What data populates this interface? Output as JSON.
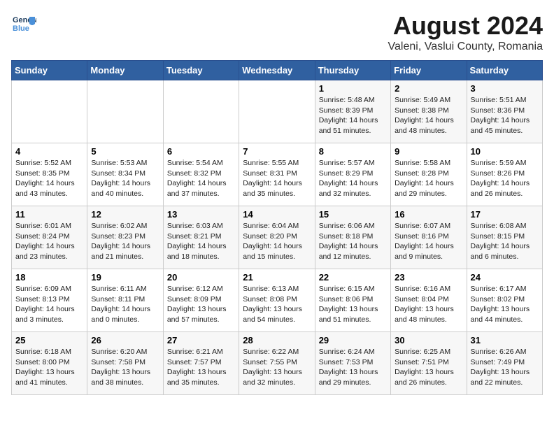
{
  "logo": {
    "line1": "General",
    "line2": "Blue"
  },
  "title": "August 2024",
  "subtitle": "Valeni, Vaslui County, Romania",
  "days_header": [
    "Sunday",
    "Monday",
    "Tuesday",
    "Wednesday",
    "Thursday",
    "Friday",
    "Saturday"
  ],
  "weeks": [
    [
      {
        "day": "",
        "info": ""
      },
      {
        "day": "",
        "info": ""
      },
      {
        "day": "",
        "info": ""
      },
      {
        "day": "",
        "info": ""
      },
      {
        "day": "1",
        "info": "Sunrise: 5:48 AM\nSunset: 8:39 PM\nDaylight: 14 hours\nand 51 minutes."
      },
      {
        "day": "2",
        "info": "Sunrise: 5:49 AM\nSunset: 8:38 PM\nDaylight: 14 hours\nand 48 minutes."
      },
      {
        "day": "3",
        "info": "Sunrise: 5:51 AM\nSunset: 8:36 PM\nDaylight: 14 hours\nand 45 minutes."
      }
    ],
    [
      {
        "day": "4",
        "info": "Sunrise: 5:52 AM\nSunset: 8:35 PM\nDaylight: 14 hours\nand 43 minutes."
      },
      {
        "day": "5",
        "info": "Sunrise: 5:53 AM\nSunset: 8:34 PM\nDaylight: 14 hours\nand 40 minutes."
      },
      {
        "day": "6",
        "info": "Sunrise: 5:54 AM\nSunset: 8:32 PM\nDaylight: 14 hours\nand 37 minutes."
      },
      {
        "day": "7",
        "info": "Sunrise: 5:55 AM\nSunset: 8:31 PM\nDaylight: 14 hours\nand 35 minutes."
      },
      {
        "day": "8",
        "info": "Sunrise: 5:57 AM\nSunset: 8:29 PM\nDaylight: 14 hours\nand 32 minutes."
      },
      {
        "day": "9",
        "info": "Sunrise: 5:58 AM\nSunset: 8:28 PM\nDaylight: 14 hours\nand 29 minutes."
      },
      {
        "day": "10",
        "info": "Sunrise: 5:59 AM\nSunset: 8:26 PM\nDaylight: 14 hours\nand 26 minutes."
      }
    ],
    [
      {
        "day": "11",
        "info": "Sunrise: 6:01 AM\nSunset: 8:24 PM\nDaylight: 14 hours\nand 23 minutes."
      },
      {
        "day": "12",
        "info": "Sunrise: 6:02 AM\nSunset: 8:23 PM\nDaylight: 14 hours\nand 21 minutes."
      },
      {
        "day": "13",
        "info": "Sunrise: 6:03 AM\nSunset: 8:21 PM\nDaylight: 14 hours\nand 18 minutes."
      },
      {
        "day": "14",
        "info": "Sunrise: 6:04 AM\nSunset: 8:20 PM\nDaylight: 14 hours\nand 15 minutes."
      },
      {
        "day": "15",
        "info": "Sunrise: 6:06 AM\nSunset: 8:18 PM\nDaylight: 14 hours\nand 12 minutes."
      },
      {
        "day": "16",
        "info": "Sunrise: 6:07 AM\nSunset: 8:16 PM\nDaylight: 14 hours\nand 9 minutes."
      },
      {
        "day": "17",
        "info": "Sunrise: 6:08 AM\nSunset: 8:15 PM\nDaylight: 14 hours\nand 6 minutes."
      }
    ],
    [
      {
        "day": "18",
        "info": "Sunrise: 6:09 AM\nSunset: 8:13 PM\nDaylight: 14 hours\nand 3 minutes."
      },
      {
        "day": "19",
        "info": "Sunrise: 6:11 AM\nSunset: 8:11 PM\nDaylight: 14 hours\nand 0 minutes."
      },
      {
        "day": "20",
        "info": "Sunrise: 6:12 AM\nSunset: 8:09 PM\nDaylight: 13 hours\nand 57 minutes."
      },
      {
        "day": "21",
        "info": "Sunrise: 6:13 AM\nSunset: 8:08 PM\nDaylight: 13 hours\nand 54 minutes."
      },
      {
        "day": "22",
        "info": "Sunrise: 6:15 AM\nSunset: 8:06 PM\nDaylight: 13 hours\nand 51 minutes."
      },
      {
        "day": "23",
        "info": "Sunrise: 6:16 AM\nSunset: 8:04 PM\nDaylight: 13 hours\nand 48 minutes."
      },
      {
        "day": "24",
        "info": "Sunrise: 6:17 AM\nSunset: 8:02 PM\nDaylight: 13 hours\nand 44 minutes."
      }
    ],
    [
      {
        "day": "25",
        "info": "Sunrise: 6:18 AM\nSunset: 8:00 PM\nDaylight: 13 hours\nand 41 minutes."
      },
      {
        "day": "26",
        "info": "Sunrise: 6:20 AM\nSunset: 7:58 PM\nDaylight: 13 hours\nand 38 minutes."
      },
      {
        "day": "27",
        "info": "Sunrise: 6:21 AM\nSunset: 7:57 PM\nDaylight: 13 hours\nand 35 minutes."
      },
      {
        "day": "28",
        "info": "Sunrise: 6:22 AM\nSunset: 7:55 PM\nDaylight: 13 hours\nand 32 minutes."
      },
      {
        "day": "29",
        "info": "Sunrise: 6:24 AM\nSunset: 7:53 PM\nDaylight: 13 hours\nand 29 minutes."
      },
      {
        "day": "30",
        "info": "Sunrise: 6:25 AM\nSunset: 7:51 PM\nDaylight: 13 hours\nand 26 minutes."
      },
      {
        "day": "31",
        "info": "Sunrise: 6:26 AM\nSunset: 7:49 PM\nDaylight: 13 hours\nand 22 minutes."
      }
    ]
  ]
}
